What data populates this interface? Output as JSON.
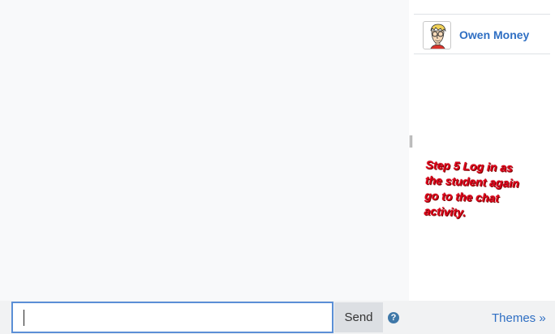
{
  "users": [
    {
      "name": "Owen Money",
      "avatar_icon": "cartoon-user-avatar-icon"
    }
  ],
  "annotation": {
    "lines": [
      "Step 5 Log in as",
      "the student again",
      "go to the chat",
      "activity."
    ],
    "color": "#e0001a"
  },
  "composer": {
    "input_value": "",
    "send_label": "Send",
    "help_icon_glyph": "?",
    "themes_label": "Themes »"
  },
  "colors": {
    "link": "#2f6fc3",
    "input_border": "#5b8fd6",
    "footer_bg": "#f1f2f3",
    "chat_bg": "#f8f9fa"
  }
}
